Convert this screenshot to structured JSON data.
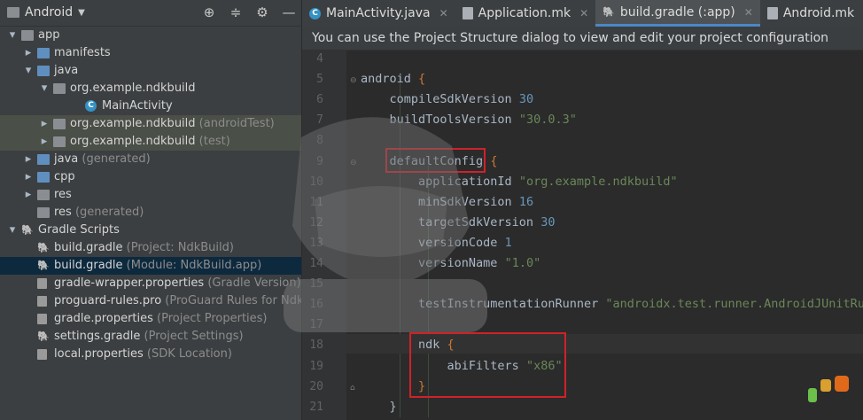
{
  "project_panel": {
    "title": "Android",
    "tree": [
      {
        "label": "app",
        "suffix": "",
        "depth": 0,
        "arrow": "open",
        "icon": "module-folder",
        "state": ""
      },
      {
        "label": "manifests",
        "suffix": "",
        "depth": 1,
        "arrow": "closed",
        "icon": "folder-blue",
        "state": ""
      },
      {
        "label": "java",
        "suffix": "",
        "depth": 1,
        "arrow": "open",
        "icon": "folder-blue",
        "state": ""
      },
      {
        "label": "org.example.ndkbuild",
        "suffix": "",
        "depth": 2,
        "arrow": "open",
        "icon": "package",
        "state": ""
      },
      {
        "label": "MainActivity",
        "suffix": "",
        "depth": 4,
        "arrow": "",
        "icon": "class",
        "state": ""
      },
      {
        "label": "org.example.ndkbuild",
        "suffix": "(androidTest)",
        "depth": 2,
        "arrow": "closed",
        "icon": "package",
        "state": "hl"
      },
      {
        "label": "org.example.ndkbuild",
        "suffix": "(test)",
        "depth": 2,
        "arrow": "closed",
        "icon": "package",
        "state": "hl"
      },
      {
        "label": "java",
        "suffix": "(generated)",
        "depth": 1,
        "arrow": "closed",
        "icon": "folder-blue",
        "state": ""
      },
      {
        "label": "cpp",
        "suffix": "",
        "depth": 1,
        "arrow": "closed",
        "icon": "folder-blue",
        "state": ""
      },
      {
        "label": "res",
        "suffix": "",
        "depth": 1,
        "arrow": "closed",
        "icon": "folder-gray",
        "state": ""
      },
      {
        "label": "res",
        "suffix": "(generated)",
        "depth": 1,
        "arrow": "",
        "icon": "folder-gray",
        "state": ""
      },
      {
        "label": "Gradle Scripts",
        "suffix": "",
        "depth": 0,
        "arrow": "open",
        "icon": "gradle",
        "state": ""
      },
      {
        "label": "build.gradle",
        "suffix": "(Project: NdkBuild)",
        "depth": 1,
        "arrow": "",
        "icon": "gradle",
        "state": ""
      },
      {
        "label": "build.gradle",
        "suffix": "(Module: NdkBuild.app)",
        "depth": 1,
        "arrow": "",
        "icon": "gradle",
        "state": "sel"
      },
      {
        "label": "gradle-wrapper.properties",
        "suffix": "(Gradle Version)",
        "depth": 1,
        "arrow": "",
        "icon": "props",
        "state": ""
      },
      {
        "label": "proguard-rules.pro",
        "suffix": "(ProGuard Rules for NdkBu",
        "depth": 1,
        "arrow": "",
        "icon": "props",
        "state": ""
      },
      {
        "label": "gradle.properties",
        "suffix": "(Project Properties)",
        "depth": 1,
        "arrow": "",
        "icon": "props",
        "state": ""
      },
      {
        "label": "settings.gradle",
        "suffix": "(Project Settings)",
        "depth": 1,
        "arrow": "",
        "icon": "gradle",
        "state": ""
      },
      {
        "label": "local.properties",
        "suffix": "(SDK Location)",
        "depth": 1,
        "arrow": "",
        "icon": "props",
        "state": ""
      }
    ]
  },
  "tabs": [
    {
      "label": "MainActivity.java",
      "icon": "class",
      "active": false
    },
    {
      "label": "Application.mk",
      "icon": "doc",
      "active": false
    },
    {
      "label": "build.gradle (:app)",
      "icon": "gradle",
      "active": true
    },
    {
      "label": "Android.mk",
      "icon": "doc",
      "active": false
    }
  ],
  "banner": "You can use the Project Structure dialog to view and edit your project configuration",
  "code": [
    {
      "n": "4",
      "tokens": []
    },
    {
      "n": "5",
      "tokens": [
        [
          "p",
          "android "
        ],
        [
          "kw",
          "{"
        ]
      ]
    },
    {
      "n": "6",
      "tokens": [
        [
          "p",
          "    compileSdkVersion "
        ],
        [
          "num",
          "30"
        ]
      ]
    },
    {
      "n": "7",
      "tokens": [
        [
          "p",
          "    buildToolsVersion "
        ],
        [
          "str",
          "\"30.0.3\""
        ]
      ]
    },
    {
      "n": "8",
      "tokens": []
    },
    {
      "n": "9",
      "tokens": [
        [
          "p",
          "    defaultConfig "
        ],
        [
          "kw",
          "{"
        ]
      ]
    },
    {
      "n": "10",
      "tokens": [
        [
          "p",
          "        applicationId "
        ],
        [
          "str",
          "\"org.example.ndkbuild\""
        ]
      ]
    },
    {
      "n": "11",
      "tokens": [
        [
          "p",
          "        minSdkVersion "
        ],
        [
          "num",
          "16"
        ]
      ]
    },
    {
      "n": "12",
      "tokens": [
        [
          "p",
          "        targetSdkVersion "
        ],
        [
          "num",
          "30"
        ]
      ]
    },
    {
      "n": "13",
      "tokens": [
        [
          "p",
          "        versionCode "
        ],
        [
          "num",
          "1"
        ]
      ]
    },
    {
      "n": "14",
      "tokens": [
        [
          "p",
          "        versionName "
        ],
        [
          "str",
          "\"1.0\""
        ]
      ]
    },
    {
      "n": "15",
      "tokens": []
    },
    {
      "n": "16",
      "tokens": [
        [
          "p",
          "        testInstrumentationRunner "
        ],
        [
          "str",
          "\"androidx.test.runner.AndroidJUnitRun"
        ]
      ]
    },
    {
      "n": "17",
      "tokens": []
    },
    {
      "n": "18",
      "tokens": [
        [
          "p",
          "        ndk "
        ],
        [
          "kw",
          "{"
        ]
      ]
    },
    {
      "n": "19",
      "tokens": [
        [
          "p",
          "            abiFilters "
        ],
        [
          "str",
          "\"x86\""
        ]
      ]
    },
    {
      "n": "20",
      "tokens": [
        [
          "kw",
          "        }"
        ]
      ]
    },
    {
      "n": "21",
      "tokens": [
        [
          "p",
          "    }"
        ]
      ]
    }
  ],
  "colors": {
    "accent": "#4a88c7",
    "highlight_box": "#d0212a",
    "selection": "#0d293e"
  }
}
